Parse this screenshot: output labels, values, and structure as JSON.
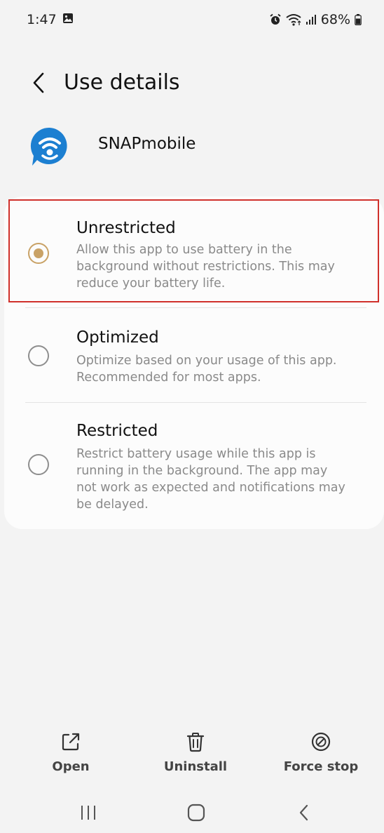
{
  "status_bar": {
    "time": "1:47",
    "battery": "68%"
  },
  "header": {
    "title": "Use details"
  },
  "app": {
    "name": "SNAPmobile",
    "icon": "snapmobile-wifi-chat-icon",
    "icon_color": "#1c7fd1"
  },
  "options": [
    {
      "title": "Unrestricted",
      "description": "Allow this app to use battery in the background without restrictions. This may reduce your battery life.",
      "selected": true
    },
    {
      "title": "Optimized",
      "description": "Optimize based on your usage of this app. Recommended for most apps.",
      "selected": false
    },
    {
      "title": "Restricted",
      "description": "Restrict battery usage while this app is running in the background. The app may not work as expected and notifications may be delayed.",
      "selected": false
    }
  ],
  "actions": [
    {
      "label": "Open",
      "icon": "open-external-icon"
    },
    {
      "label": "Uninstall",
      "icon": "trash-icon"
    },
    {
      "label": "Force stop",
      "icon": "force-stop-icon"
    }
  ],
  "colors": {
    "accent": "#c9a266",
    "highlight": "#d0302b",
    "background": "#f3f3f3",
    "card": "#fcfcfc"
  }
}
